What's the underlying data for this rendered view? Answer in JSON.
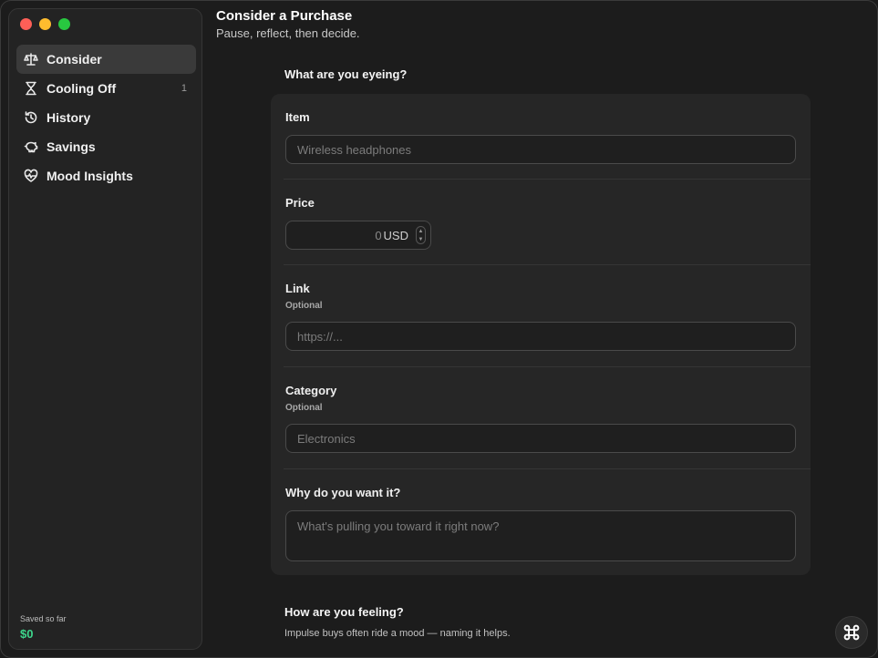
{
  "window": {
    "traffic_lights": [
      "close",
      "minimize",
      "zoom"
    ]
  },
  "sidebar": {
    "items": [
      {
        "label": "Consider",
        "icon": "scale-icon",
        "active": true,
        "badge": ""
      },
      {
        "label": "Cooling Off",
        "icon": "hourglass-icon",
        "active": false,
        "badge": "1"
      },
      {
        "label": "History",
        "icon": "history-icon",
        "active": false,
        "badge": ""
      },
      {
        "label": "Savings",
        "icon": "piggy-bank-icon",
        "active": false,
        "badge": ""
      },
      {
        "label": "Mood Insights",
        "icon": "heart-pulse-icon",
        "active": false,
        "badge": ""
      }
    ],
    "saved_label": "Saved so far",
    "saved_value": "$0"
  },
  "header": {
    "title": "Consider a Purchase",
    "subtitle": "Pause, reflect, then decide."
  },
  "form": {
    "section_title": "What are you eyeing?",
    "item": {
      "label": "Item",
      "placeholder": "Wireless headphones",
      "value": ""
    },
    "price": {
      "label": "Price",
      "value": "0",
      "unit": "USD"
    },
    "link": {
      "label": "Link",
      "hint": "Optional",
      "placeholder": "https://...",
      "value": ""
    },
    "category": {
      "label": "Category",
      "hint": "Optional",
      "placeholder": "Electronics",
      "value": ""
    },
    "reason": {
      "label": "Why do you want it?",
      "placeholder": "What's pulling you toward it right now?",
      "value": ""
    }
  },
  "feeling": {
    "title": "How are you feeling?",
    "subtitle": "Impulse buys often ride a mood — naming it helps."
  },
  "colors": {
    "accent_green": "#3dd68c",
    "close": "#ff5f57",
    "minimize": "#febc2e",
    "zoom": "#28c840"
  }
}
